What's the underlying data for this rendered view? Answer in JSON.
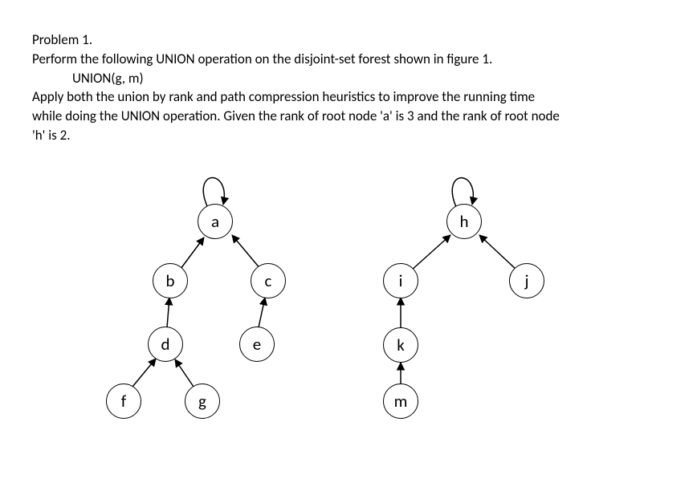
{
  "problem": {
    "title": "Problem 1.",
    "line1": "Perform the following UNION operation on the disjoint-set forest shown in figure 1.",
    "operation": "UNION(g, m)",
    "line2a": "Apply both the union by rank and path compression heuristics to improve the running time",
    "line2b": "while doing the UNION operation. Given the rank of root node 'a' is 3 and the rank of root node",
    "line2c": "'h' is 2."
  },
  "nodes": {
    "a": "a",
    "b": "b",
    "c": "c",
    "d": "d",
    "e": "e",
    "f": "f",
    "g": "g",
    "h": "h",
    "i": "i",
    "j": "j",
    "k": "k",
    "m": "m"
  },
  "tree_data": {
    "roots": [
      {
        "id": "a",
        "rank": 3
      },
      {
        "id": "h",
        "rank": 2
      }
    ],
    "parent_pointers": [
      {
        "child": "a",
        "parent": "a"
      },
      {
        "child": "b",
        "parent": "a"
      },
      {
        "child": "c",
        "parent": "a"
      },
      {
        "child": "d",
        "parent": "b"
      },
      {
        "child": "e",
        "parent": "c"
      },
      {
        "child": "f",
        "parent": "d"
      },
      {
        "child": "g",
        "parent": "d"
      },
      {
        "child": "h",
        "parent": "h"
      },
      {
        "child": "i",
        "parent": "h"
      },
      {
        "child": "j",
        "parent": "h"
      },
      {
        "child": "k",
        "parent": "i"
      },
      {
        "child": "m",
        "parent": "k"
      }
    ],
    "operation": {
      "name": "UNION",
      "args": [
        "g",
        "m"
      ]
    }
  }
}
